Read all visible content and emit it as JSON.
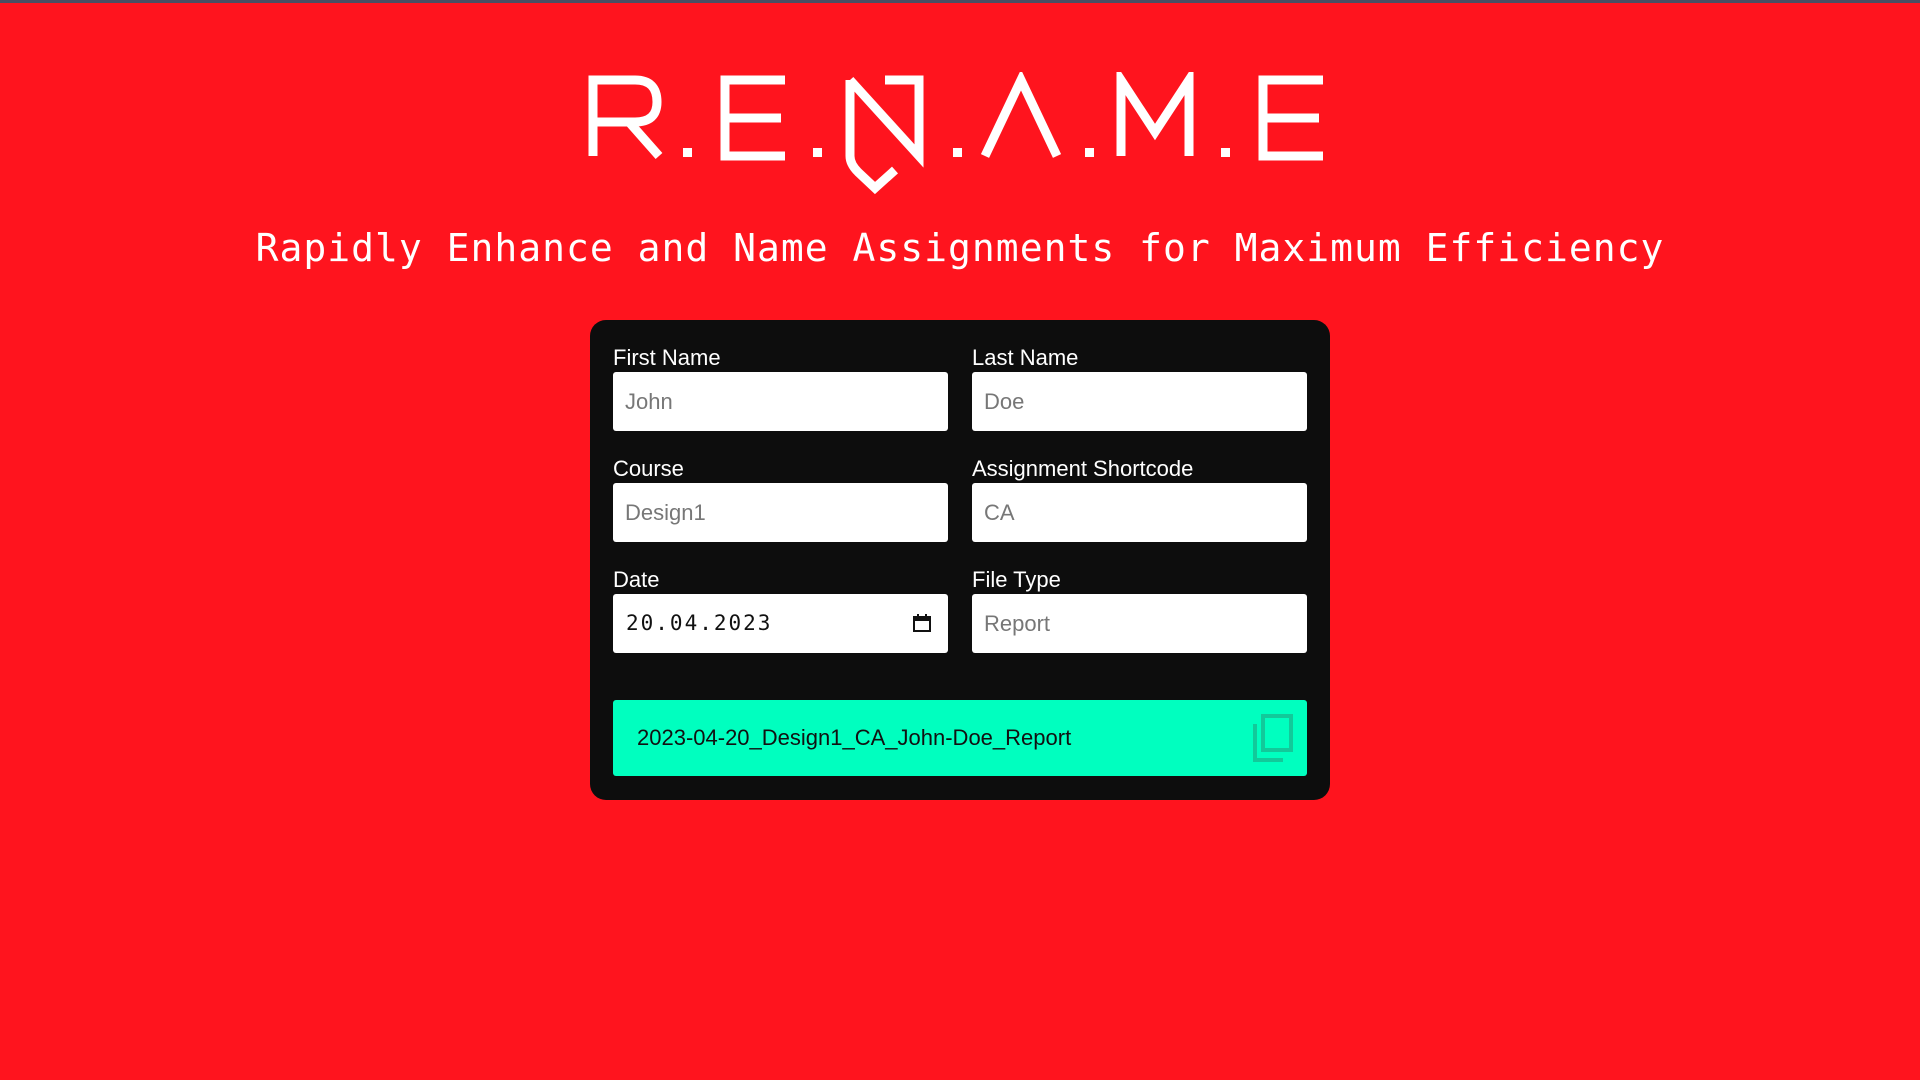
{
  "app": {
    "tagline": "Rapidly Enhance and Name Assignments for Maximum Efficiency"
  },
  "logo": {
    "letters": [
      "R",
      "E",
      "N",
      "A",
      "M",
      "E"
    ],
    "alt": "R.E.N.A.M.E"
  },
  "form": {
    "first_name": {
      "label": "First Name",
      "placeholder": "John",
      "value": ""
    },
    "last_name": {
      "label": "Last Name",
      "placeholder": "Doe",
      "value": ""
    },
    "course": {
      "label": "Course",
      "placeholder": "Design1",
      "value": ""
    },
    "assignment_shortcode": {
      "label": "Assignment Shortcode",
      "placeholder": "CA",
      "value": ""
    },
    "date": {
      "label": "Date",
      "value": "20.04.2023"
    },
    "file_type": {
      "label": "File Type",
      "placeholder": "Report",
      "value": ""
    }
  },
  "result": {
    "filename": "2023-04-20_Design1_CA_John-Doe_Report",
    "copy_icon": "copy-icon"
  },
  "colors": {
    "background": "#ff141e",
    "panel": "#0d0d0d",
    "result_accent": "#00ffbf",
    "text_light": "#ffffff"
  }
}
